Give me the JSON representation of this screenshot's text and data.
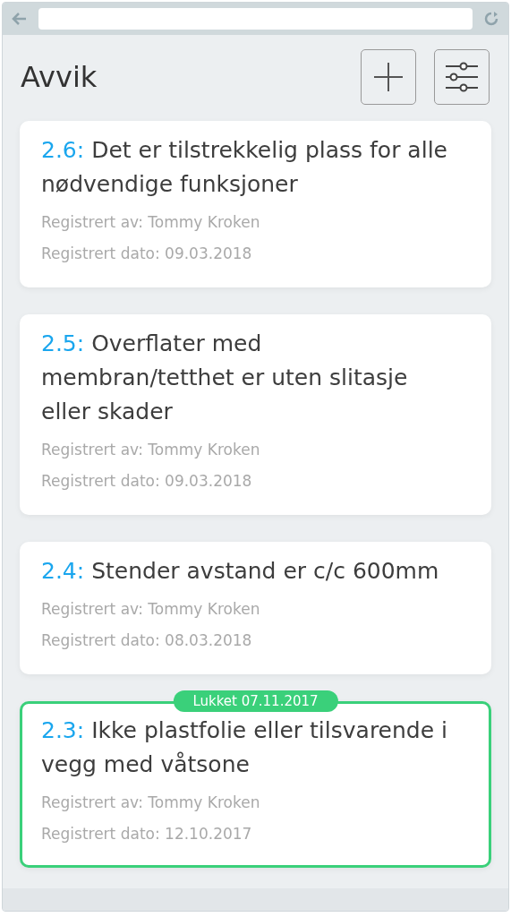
{
  "page": {
    "title": "Avvik"
  },
  "items": [
    {
      "number": "2.6:",
      "title": "Det er tilstrekkelig plass for alle nødvendige funksjoner",
      "registered_by": "Registrert av: Tommy Kroken",
      "registered_date": "Registrert dato: 09.03.2018",
      "closed": false
    },
    {
      "number": "2.5:",
      "title": "Overflater med membran/tetthet er uten slitasje eller skader",
      "registered_by": "Registrert av: Tommy Kroken",
      "registered_date": "Registrert dato: 09.03.2018",
      "closed": false
    },
    {
      "number": "2.4:",
      "title": "Stender avstand er c/c 600mm",
      "registered_by": "Registrert av: Tommy Kroken",
      "registered_date": "Registrert dato: 08.03.2018",
      "closed": false
    },
    {
      "number": "2.3:",
      "title": "Ikke plastfolie eller tilsvarende i vegg med våtsone",
      "registered_by": "Registrert av: Tommy Kroken",
      "registered_date": "Registrert dato: 12.10.2017",
      "closed": true,
      "closed_label": "Lukket 07.11.2017"
    }
  ]
}
